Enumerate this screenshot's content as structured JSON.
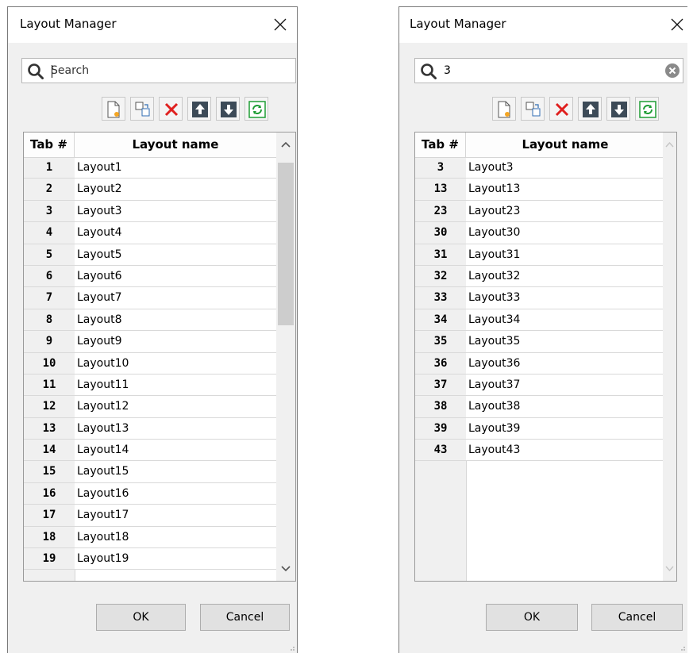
{
  "left_dialog": {
    "title": "Layout Manager",
    "search": {
      "value": "",
      "placeholder": "Search"
    },
    "toolbar": [
      "new-layout-icon",
      "copy-layout-icon",
      "delete-icon",
      "move-up-icon",
      "move-down-icon",
      "refresh-icon"
    ],
    "columns": [
      "Tab #",
      "Layout name"
    ],
    "rows": [
      {
        "tab": "1",
        "name": "Layout1"
      },
      {
        "tab": "2",
        "name": "Layout2"
      },
      {
        "tab": "3",
        "name": "Layout3"
      },
      {
        "tab": "4",
        "name": "Layout4"
      },
      {
        "tab": "5",
        "name": "Layout5"
      },
      {
        "tab": "6",
        "name": "Layout6"
      },
      {
        "tab": "7",
        "name": "Layout7"
      },
      {
        "tab": "8",
        "name": "Layout8"
      },
      {
        "tab": "9",
        "name": "Layout9"
      },
      {
        "tab": "10",
        "name": "Layout10"
      },
      {
        "tab": "11",
        "name": "Layout11"
      },
      {
        "tab": "12",
        "name": "Layout12"
      },
      {
        "tab": "13",
        "name": "Layout13"
      },
      {
        "tab": "14",
        "name": "Layout14"
      },
      {
        "tab": "15",
        "name": "Layout15"
      },
      {
        "tab": "16",
        "name": "Layout16"
      },
      {
        "tab": "17",
        "name": "Layout17"
      },
      {
        "tab": "18",
        "name": "Layout18"
      },
      {
        "tab": "19",
        "name": "Layout19"
      }
    ],
    "ok_label": "OK",
    "cancel_label": "Cancel"
  },
  "right_dialog": {
    "title": "Layout Manager",
    "search": {
      "value": "3",
      "placeholder": ""
    },
    "toolbar": [
      "new-layout-icon",
      "copy-layout-icon",
      "delete-icon",
      "move-up-icon",
      "move-down-icon",
      "refresh-icon"
    ],
    "columns": [
      "Tab #",
      "Layout name"
    ],
    "rows": [
      {
        "tab": "3",
        "name": "Layout3"
      },
      {
        "tab": "13",
        "name": "Layout13"
      },
      {
        "tab": "23",
        "name": "Layout23"
      },
      {
        "tab": "30",
        "name": "Layout30"
      },
      {
        "tab": "31",
        "name": "Layout31"
      },
      {
        "tab": "32",
        "name": "Layout32"
      },
      {
        "tab": "33",
        "name": "Layout33"
      },
      {
        "tab": "34",
        "name": "Layout34"
      },
      {
        "tab": "35",
        "name": "Layout35"
      },
      {
        "tab": "36",
        "name": "Layout36"
      },
      {
        "tab": "37",
        "name": "Layout37"
      },
      {
        "tab": "38",
        "name": "Layout38"
      },
      {
        "tab": "39",
        "name": "Layout39"
      },
      {
        "tab": "43",
        "name": "Layout43"
      }
    ],
    "ok_label": "OK",
    "cancel_label": "Cancel"
  },
  "colors": {
    "dialog_bg": "#f0f0f0",
    "title_bg": "#ffffff",
    "delete_red": "#e0201f",
    "refresh_green": "#1e9d35"
  }
}
